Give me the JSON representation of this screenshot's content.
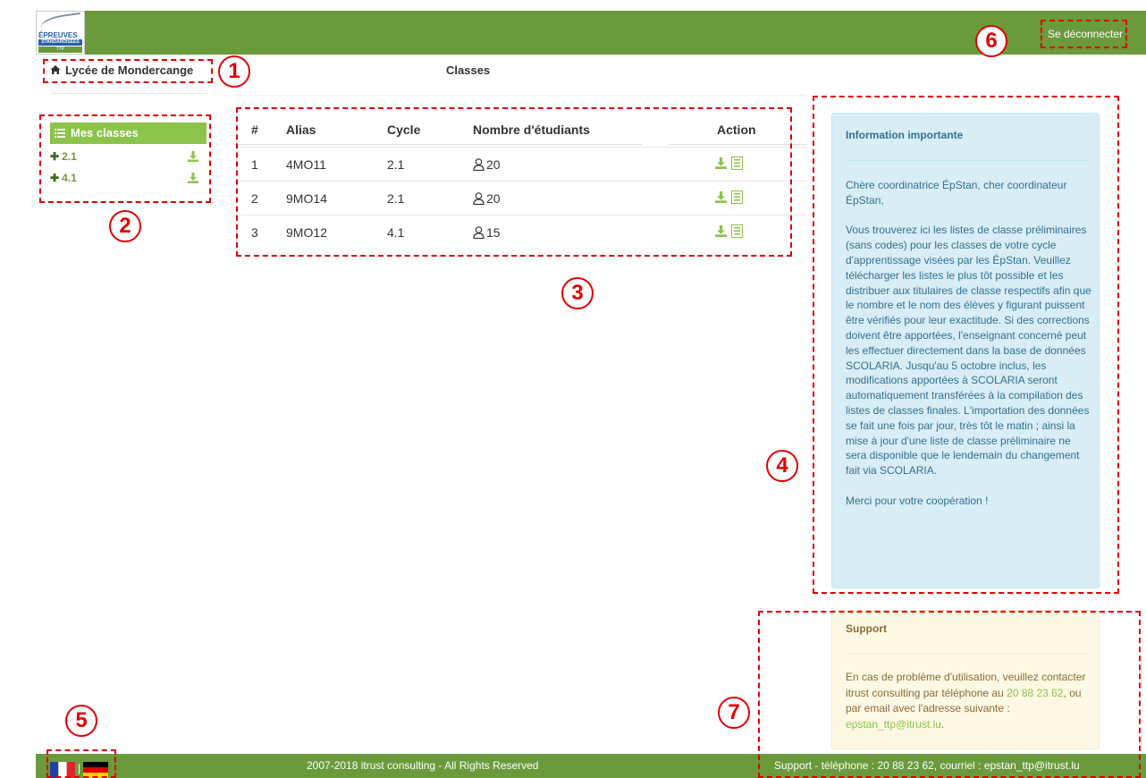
{
  "header": {
    "logo": {
      "line1": "ÉPREUVES",
      "line2": "STANDARDISÉES",
      "line3": "TTP"
    },
    "logout_label": "Se déconnecter"
  },
  "breadcrumb": {
    "school": "Lycée de Mondercange",
    "page_title": "Classes"
  },
  "sidebar": {
    "heading": "Mes classes",
    "items": [
      {
        "label": "2.1"
      },
      {
        "label": "4.1"
      }
    ]
  },
  "table": {
    "headers": [
      "#",
      "Alias",
      "Cycle",
      "Nombre d'étudiants",
      "Action"
    ],
    "rows": [
      {
        "num": "1",
        "alias": "4MO11",
        "cycle": "2.1",
        "students": "20"
      },
      {
        "num": "2",
        "alias": "9MO14",
        "cycle": "2.1",
        "students": "20"
      },
      {
        "num": "3",
        "alias": "9MO12",
        "cycle": "4.1",
        "students": "15"
      }
    ]
  },
  "info": {
    "title": "Information importante",
    "greeting": "Chère coordinatrice ÉpStan, cher coordinateur ÉpStan,",
    "body": "Vous trouverez ici les listes de classe préliminaires (sans codes) pour les classes de votre cycle d'apprentissage visées par les ÉpStan. Veuillez télécharger les listes le plus tôt possible et les distribuer aux titulaires de classe respectifs afin que le nombre et le nom des élèves y figurant puissent être vérifiés pour leur exactitude. Si des corrections doivent être apportées, l'enseignant concerné peut les effectuer directement dans la base de données SCOLARIA. Jusqu'au 5 octobre inclus, les modifications apportées à SCOLARIA seront automatiquement transférées à la compilation des listes de classes finales. L'importation des données se fait une fois par jour, très tôt le matin ; ainsi la mise à jour d'une liste de classe préliminaire ne sera disponible que le lendemain du changement fait via SCOLARIA.",
    "closing": "Merci pour votre coopération !"
  },
  "support": {
    "title": "Support",
    "text1": "En cas de problème d'utilisation, veuillez contacter itrust consulting par téléphone au",
    "phone": "20 88 23 62",
    "text2": ", ou par email avec l'adresse suivante :",
    "email": "epstan_ttp@itrust.lu",
    "text3": "."
  },
  "footer": {
    "flag_separator": "|",
    "copyright": "2007-2018 itrust consulting - All Rights Reserved",
    "support": "Support - téléphone : 20 88 23 62, courriel : epstan_ttp@itrust.lu"
  },
  "annotations": [
    "1",
    "2",
    "3",
    "4",
    "5",
    "6",
    "7"
  ],
  "colors": {
    "brand_green": "#6a9a3b",
    "accent_green": "#8cc34a",
    "annotation_red": "#e00000",
    "info_bg": "#d9edf7",
    "support_bg": "#fcf8e3"
  }
}
